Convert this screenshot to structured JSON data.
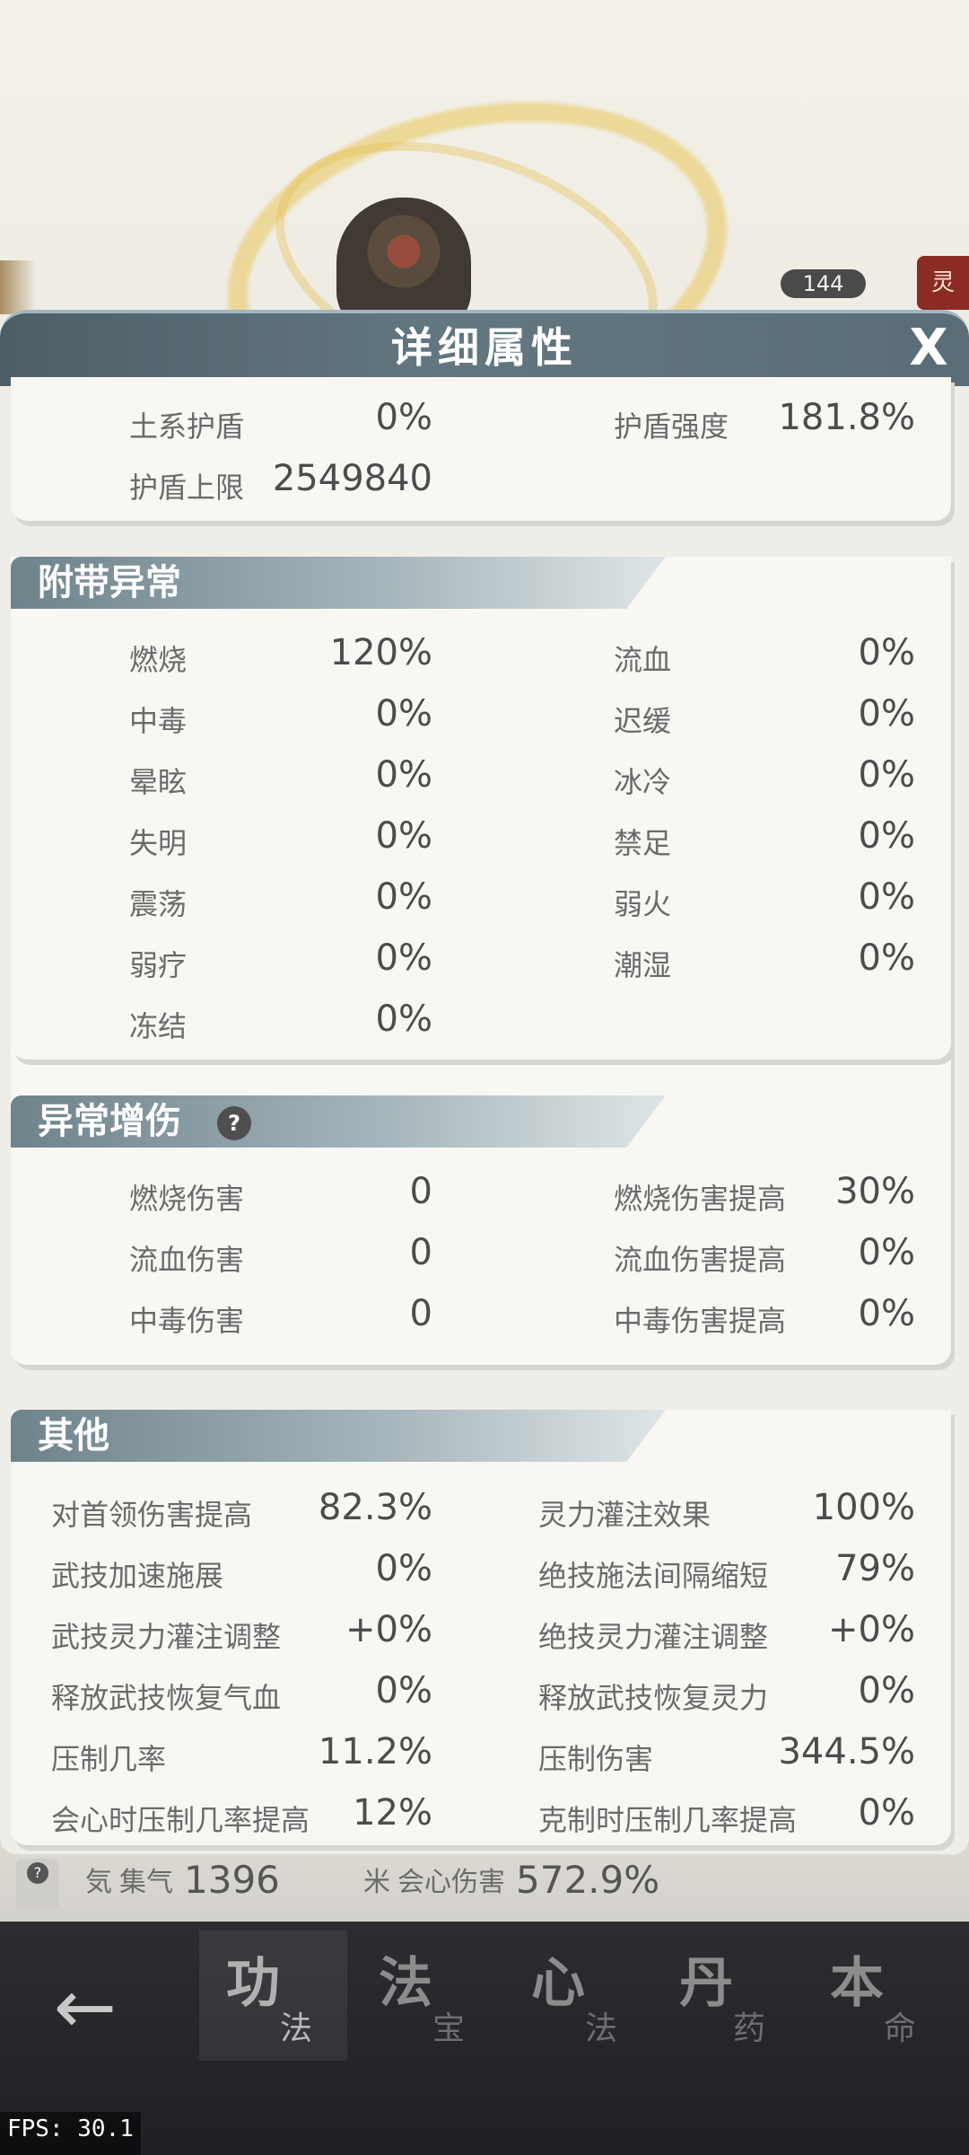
{
  "modal": {
    "title": "详细属性",
    "close_label": "X"
  },
  "shield": {
    "rows": [
      {
        "left_label": "土系护盾",
        "left_value": "0%",
        "right_label": "护盾强度",
        "right_value": "181.8%"
      },
      {
        "left_label": "护盾上限",
        "left_value": "2549840",
        "right_label": "",
        "right_value": ""
      }
    ]
  },
  "ailments": {
    "title": "附带异常",
    "rows": [
      {
        "left_label": "燃烧",
        "left_value": "120%",
        "right_label": "流血",
        "right_value": "0%"
      },
      {
        "left_label": "中毒",
        "left_value": "0%",
        "right_label": "迟缓",
        "right_value": "0%"
      },
      {
        "left_label": "晕眩",
        "left_value": "0%",
        "right_label": "冰冷",
        "right_value": "0%"
      },
      {
        "left_label": "失明",
        "left_value": "0%",
        "right_label": "禁足",
        "right_value": "0%"
      },
      {
        "left_label": "震荡",
        "left_value": "0%",
        "right_label": "弱火",
        "right_value": "0%"
      },
      {
        "left_label": "弱疗",
        "left_value": "0%",
        "right_label": "潮湿",
        "right_value": "0%"
      },
      {
        "left_label": "冻结",
        "left_value": "0%",
        "right_label": "",
        "right_value": ""
      }
    ]
  },
  "ailment_damage": {
    "title": "异常增伤",
    "help_label": "?",
    "rows": [
      {
        "left_label": "燃烧伤害",
        "left_value": "0",
        "right_label": "燃烧伤害提高",
        "right_value": "30%"
      },
      {
        "left_label": "流血伤害",
        "left_value": "0",
        "right_label": "流血伤害提高",
        "right_value": "0%"
      },
      {
        "left_label": "中毒伤害",
        "left_value": "0",
        "right_label": "中毒伤害提高",
        "right_value": "0%"
      }
    ]
  },
  "other": {
    "title": "其他",
    "rows": [
      {
        "left_label": "对首领伤害提高",
        "left_value": "82.3%",
        "right_label": "灵力灌注效果",
        "right_value": "100%"
      },
      {
        "left_label": "武技加速施展",
        "left_value": "0%",
        "right_label": "绝技施法间隔缩短",
        "right_value": "79%"
      },
      {
        "left_label": "武技灵力灌注调整",
        "left_value": "+0%",
        "right_label": "绝技灵力灌注调整",
        "right_value": "+0%"
      },
      {
        "left_label": "释放武技恢复气血",
        "left_value": "0%",
        "right_label": "释放武技恢复灵力",
        "right_value": "0%"
      },
      {
        "left_label": "压制几率",
        "left_value": "11.2%",
        "right_label": "压制伤害",
        "right_value": "344.5%"
      },
      {
        "left_label": "会心时压制几率提高",
        "left_value": "12%",
        "right_label": "克制时压制几率提高",
        "right_value": "0%"
      }
    ]
  },
  "background": {
    "level_badge": "144",
    "side_tag": "灵",
    "help_mark": "?",
    "stats": [
      {
        "icon": "気",
        "label": "集气",
        "value": "1396"
      },
      {
        "icon": "米",
        "label": "会心伤害",
        "value": "572.9%"
      }
    ]
  },
  "bottom_nav": {
    "back_label": "←",
    "tabs": [
      {
        "big": "功",
        "small": "法",
        "active": true
      },
      {
        "big": "法",
        "small": "宝",
        "active": false
      },
      {
        "big": "心",
        "small": "法",
        "active": false
      },
      {
        "big": "丹",
        "small": "药",
        "active": false
      },
      {
        "big": "本",
        "small": "命",
        "active": false
      }
    ]
  },
  "fps_label": "FPS: 30.1"
}
